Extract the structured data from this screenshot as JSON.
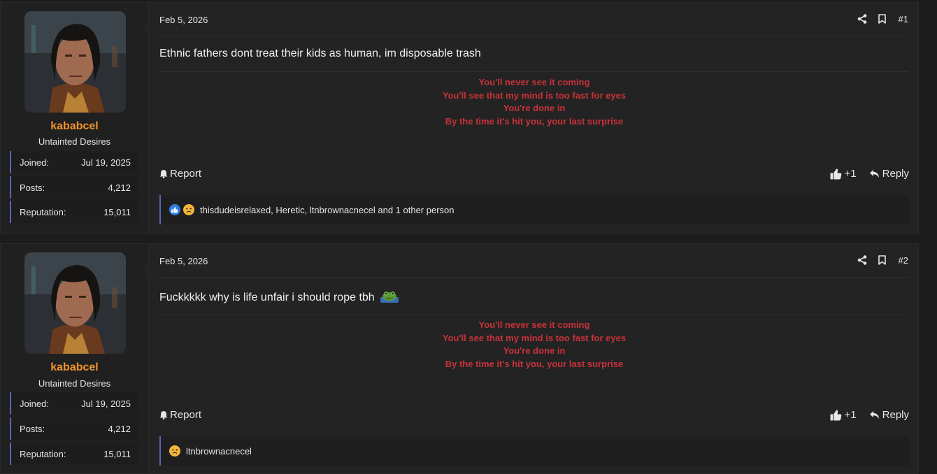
{
  "posts": [
    {
      "user": {
        "name": "kababcel",
        "title": "Untainted Desires",
        "stats": [
          {
            "label": "Joined:",
            "value": "Jul 19, 2025"
          },
          {
            "label": "Posts:",
            "value": "4,212"
          },
          {
            "label": "Reputation:",
            "value": "15,011"
          }
        ]
      },
      "date": "Feb 5, 2026",
      "number": "#1",
      "message": "Ethnic fathers dont treat their kids as human, im disposable trash",
      "signature": [
        "You'll never see it coming",
        "You'll see that my mind is too fast for eyes",
        "You're done in",
        "By the time it's hit you, your last surprise"
      ],
      "report_label": "Report",
      "like_label": "+1",
      "reply_label": "Reply",
      "reactions_text": "thisdudeisrelaxed, Heretic, ltnbrownacnecel and 1 other person",
      "reaction_icons": [
        "like-icon",
        "sad-icon"
      ]
    },
    {
      "user": {
        "name": "kababcel",
        "title": "Untainted Desires",
        "stats": [
          {
            "label": "Joined:",
            "value": "Jul 19, 2025"
          },
          {
            "label": "Posts:",
            "value": "4,212"
          },
          {
            "label": "Reputation:",
            "value": "15,011"
          }
        ]
      },
      "date": "Feb 5, 2026",
      "number": "#2",
      "message": "Fuckkkkk why is life unfair i should rope tbh",
      "message_emoji": "frog-icon",
      "signature": [
        "You'll never see it coming",
        "You'll see that my mind is too fast for eyes",
        "You're done in",
        "By the time it's hit you, your last surprise"
      ],
      "report_label": "Report",
      "like_label": "+1",
      "reply_label": "Reply",
      "reactions_text": "ltnbrownacnecel",
      "reaction_icons": [
        "sad-icon"
      ]
    }
  ],
  "colors": {
    "username": "#f0932b",
    "signature": "#c8323a",
    "accent_border": "#5966b8"
  }
}
